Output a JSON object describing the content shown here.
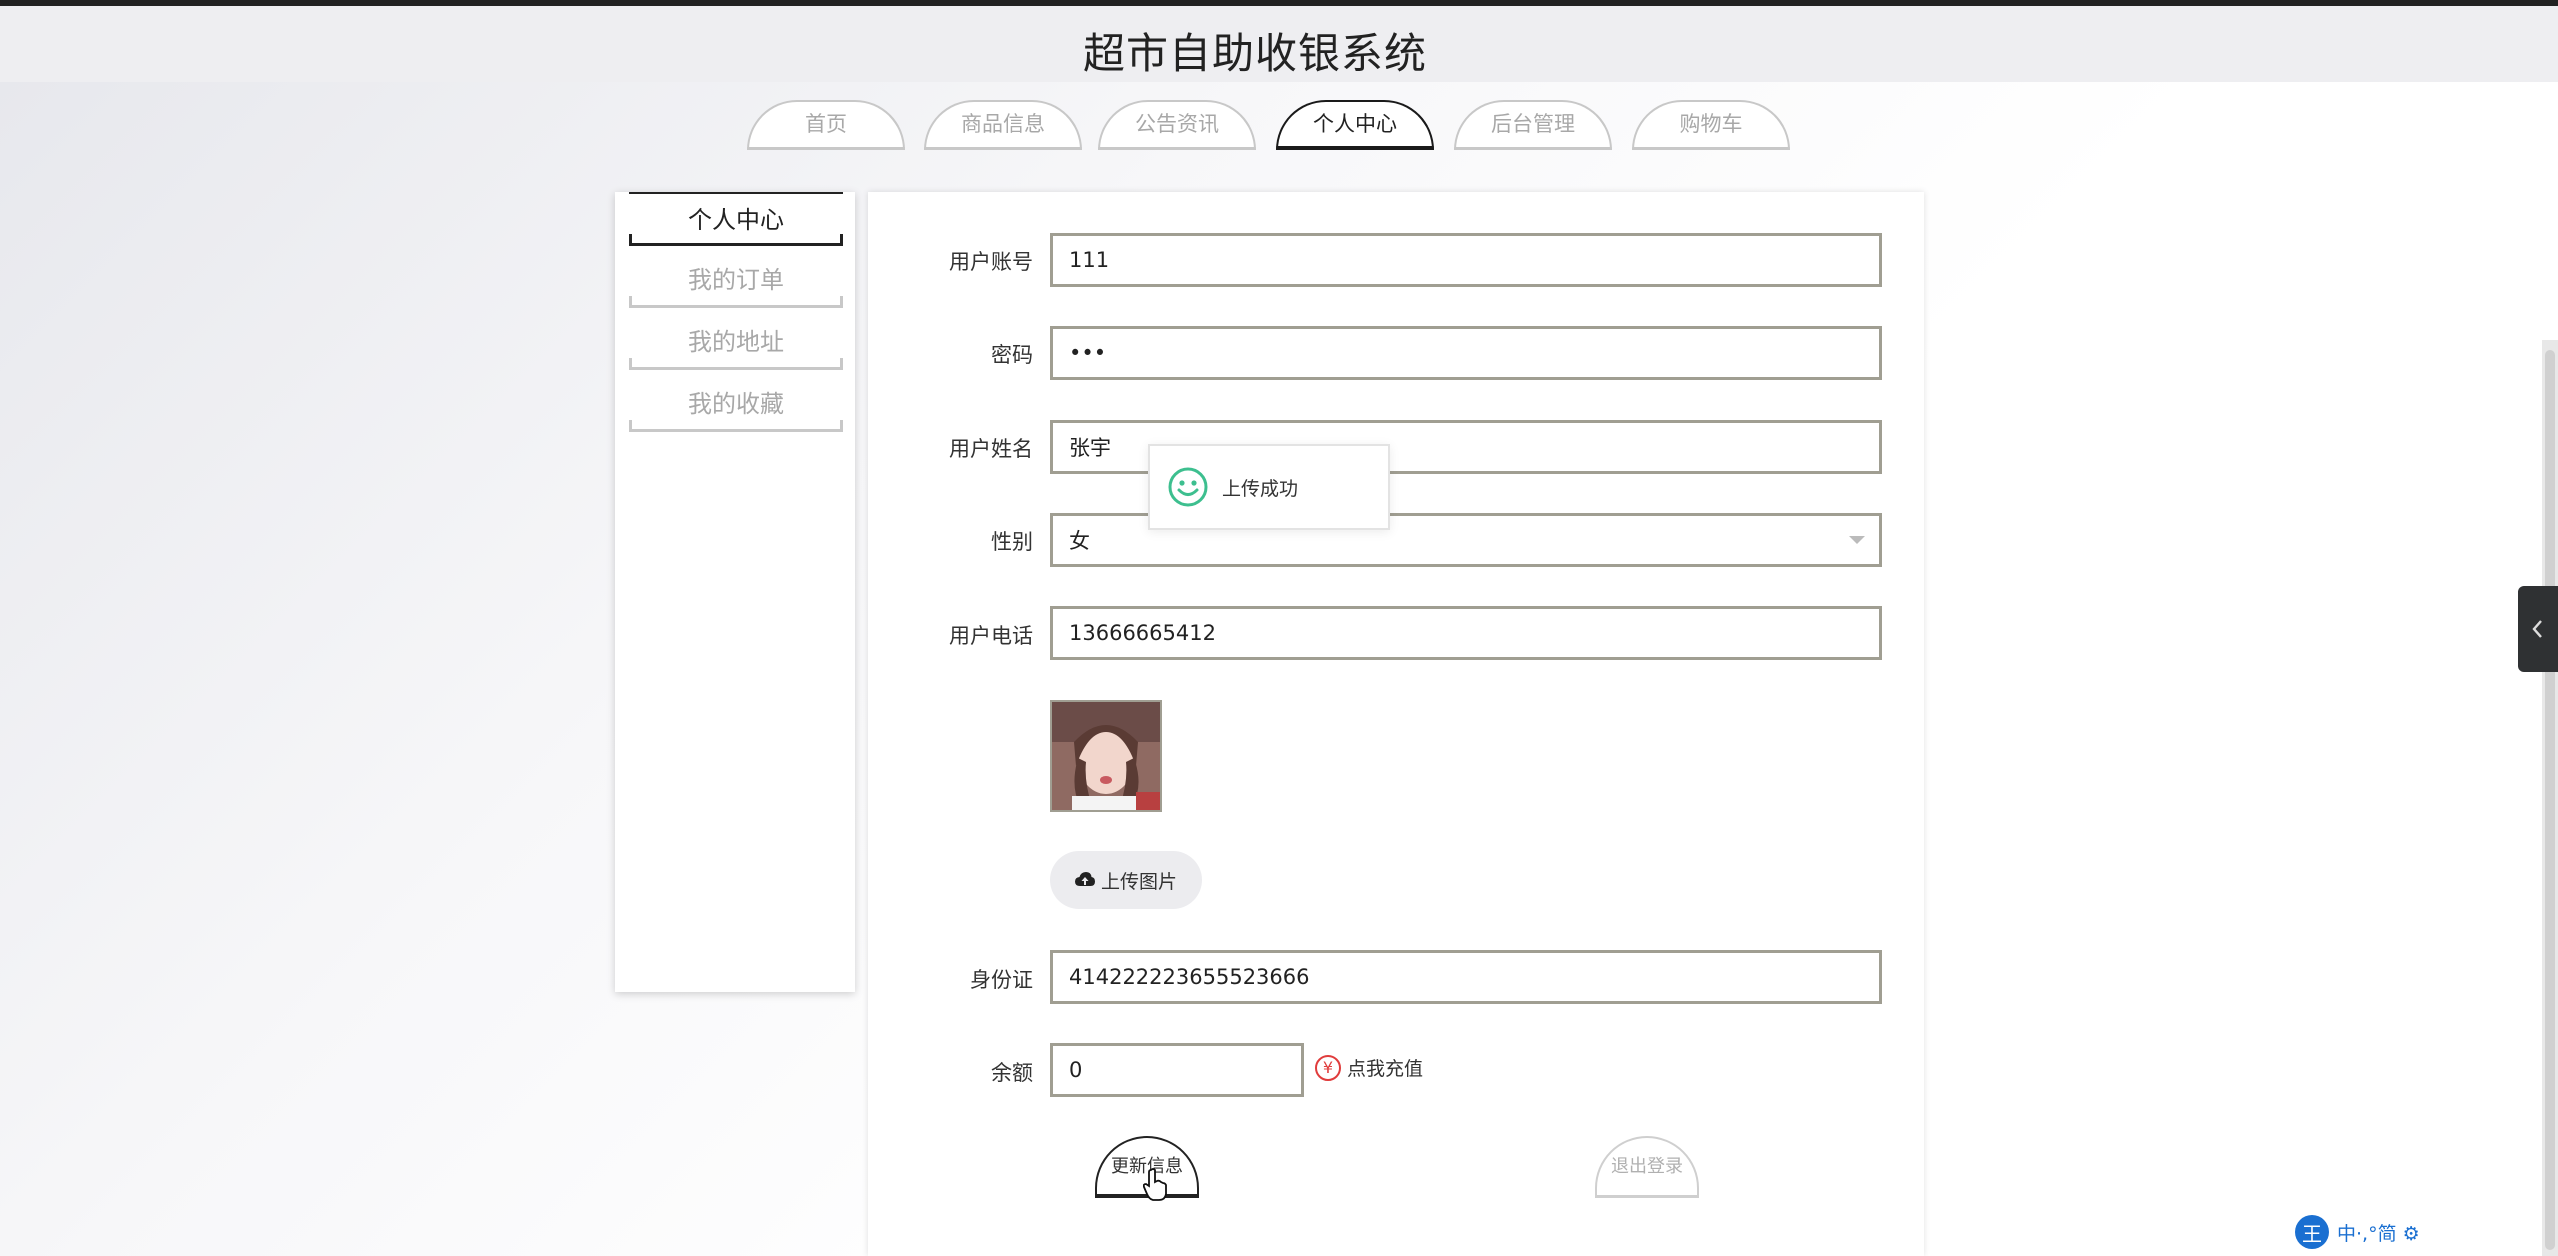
{
  "site": {
    "title": "超市自助收银系统"
  },
  "nav": {
    "tabs": [
      {
        "label": "首页"
      },
      {
        "label": "商品信息"
      },
      {
        "label": "公告资讯"
      },
      {
        "label": "个人中心",
        "active": true
      },
      {
        "label": "后台管理"
      },
      {
        "label": "购物车"
      }
    ]
  },
  "sidebar": {
    "items": [
      {
        "label": "个人中心",
        "active": true
      },
      {
        "label": "我的订单"
      },
      {
        "label": "我的地址"
      },
      {
        "label": "我的收藏"
      }
    ]
  },
  "form": {
    "account": {
      "label": "用户账号",
      "value": "111"
    },
    "password": {
      "label": "密码",
      "value": "•••"
    },
    "name": {
      "label": "用户姓名",
      "value": "张宇"
    },
    "gender": {
      "label": "性别",
      "value": "女"
    },
    "phone": {
      "label": "用户电话",
      "value": "13666665412"
    },
    "upload_label": "上传图片",
    "id_card": {
      "label": "身份证",
      "value": "414222223655523666"
    },
    "balance": {
      "label": "余额",
      "value": "0"
    },
    "recharge": {
      "label": "点我充值",
      "icon": "yen-icon"
    },
    "update_button": "更新信息",
    "logout_button": "退出登录"
  },
  "toast": {
    "message": "上传成功",
    "icon": "smile-icon"
  },
  "ime": {
    "badge": "王",
    "text": "中·,°简 ⚙"
  },
  "colors": {
    "accent": "#1a1a1a",
    "border": "#a09e92",
    "muted": "#a8a8a8",
    "success": "#3dbf8f",
    "danger": "#e03c3c"
  }
}
